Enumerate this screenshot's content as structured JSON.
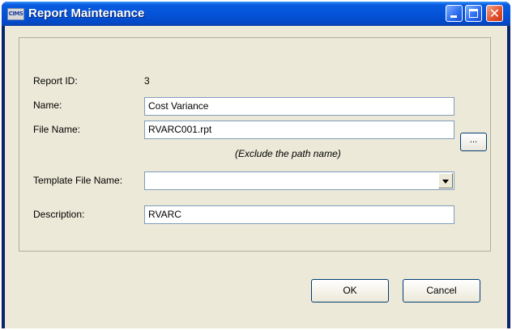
{
  "window": {
    "title": "Report Maintenance",
    "app_icon_text": "CIMS",
    "titlebar_colors": {
      "start": "#3d95ff",
      "end": "#0349c8"
    }
  },
  "form": {
    "report_id_label": "Report ID:",
    "report_id_value": "3",
    "name_label": "Name:",
    "name_value": "Cost Variance",
    "file_name_label": "File Name:",
    "file_name_value": "RVARC001.rpt",
    "file_name_hint": "(Exclude the path name)",
    "browse_label": "...",
    "template_label": "Template File Name:",
    "template_value": "",
    "description_label": "Description:",
    "description_value": "RVARC"
  },
  "buttons": {
    "ok_label": "OK",
    "cancel_label": "Cancel"
  }
}
